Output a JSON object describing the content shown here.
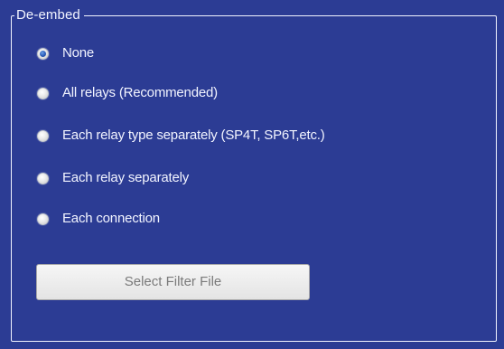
{
  "deembed": {
    "legend": "De-embed",
    "options": [
      {
        "label": "None",
        "checked": true
      },
      {
        "label": "All relays (Recommended)",
        "checked": false
      },
      {
        "label": "Each relay type separately (SP4T, SP6T,etc.)",
        "checked": false
      },
      {
        "label": "Each relay separately",
        "checked": false
      },
      {
        "label": "Each connection",
        "checked": false
      }
    ],
    "select_filter_button": {
      "label": "Select Filter File",
      "enabled": false
    }
  },
  "colors": {
    "panel_background": "#2c3c94",
    "text": "#f2f4ff",
    "disabled_button_text": "#7a7a7a",
    "radio_selected_dot": "#2a5cb8"
  }
}
